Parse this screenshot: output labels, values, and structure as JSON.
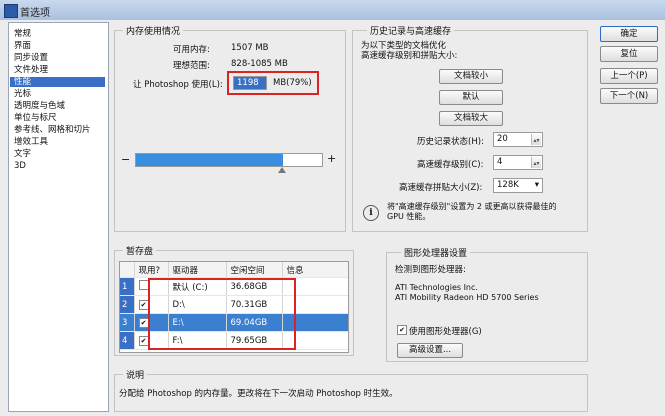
{
  "window": {
    "title": "首选项"
  },
  "sidebar": {
    "items": [
      "常规",
      "界面",
      "同步设置",
      "文件处理",
      "性能",
      "光标",
      "透明度与色域",
      "单位与标尺",
      "参考线、网格和切片",
      "增效工具",
      "文字",
      "3D"
    ],
    "selected_index": 4
  },
  "memory": {
    "group_title": "内存使用情况",
    "available_label": "可用内存:",
    "available_value": "1507 MB",
    "ideal_label": "理想范围:",
    "ideal_value": "828-1085 MB",
    "usage_label": "让 Photoshop 使用(L):",
    "usage_value": "1198",
    "usage_suffix": "MB(79%)",
    "minus": "−",
    "plus": "+",
    "slider_fraction": 0.79
  },
  "history": {
    "group_title": "历史记录与高速缓存",
    "desc_line1": "为以下类型的文档优化",
    "desc_line2": "高速缓存级别和拼贴大小:",
    "btn_small_large": "文档较小",
    "btn_default": "默认",
    "btn_large": "文档较大",
    "states_label": "历史记录状态(H):",
    "states_value": "20",
    "cache_levels_label": "高速缓存级别(C):",
    "cache_levels_value": "4",
    "tile_size_label": "高速缓存拼贴大小(Z):",
    "tile_size_value": "128K",
    "info_text_line1": "将\"高速缓存级别\"设置为 2 或更高以获得最佳的",
    "info_text_line2": "GPU 性能。"
  },
  "dialog_buttons": {
    "ok": "确定",
    "reset": "复位",
    "prev": "上一个(P)",
    "next": "下一个(N)"
  },
  "scratch": {
    "group_title": "暂存盘",
    "columns": [
      "现用?",
      "驱动器",
      "空闲空间",
      "信息"
    ],
    "rows": [
      {
        "num": "1",
        "checked": false,
        "drive": "默认 (C:)",
        "free": "36.68GB",
        "info": ""
      },
      {
        "num": "2",
        "checked": true,
        "drive": "D:\\",
        "free": "70.31GB",
        "info": ""
      },
      {
        "num": "3",
        "checked": true,
        "drive": "E:\\",
        "free": "69.04GB",
        "info": ""
      },
      {
        "num": "4",
        "checked": true,
        "drive": "F:\\",
        "free": "79.65GB",
        "info": ""
      }
    ],
    "selected_row": 2
  },
  "gpu": {
    "group_title": "图形处理器设置",
    "detected_label": "检测到图形处理器:",
    "line1": "ATI Technologies Inc.",
    "line2": "ATI Mobility Radeon HD 5700 Series",
    "use_gpu_label": "使用图形处理器(G)",
    "use_gpu_checked": "✔",
    "advanced_btn": "高级设置..."
  },
  "description": {
    "group_title": "说明",
    "text": "分配给 Photoshop 的内存量。更改将在下一次启动 Photoshop 时生效。"
  },
  "icons": {
    "info": "i",
    "check": "✔",
    "dropdown": "▾",
    "spin": "▴▾"
  }
}
